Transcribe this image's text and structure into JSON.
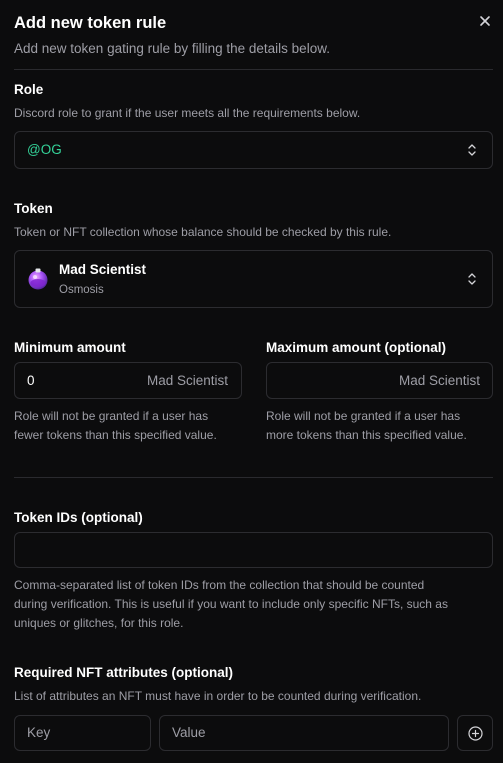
{
  "header": {
    "title": "Add new token rule",
    "subtitle": "Add new token gating rule by filling the details below.",
    "close_icon": "close-icon"
  },
  "role": {
    "label": "Role",
    "description": "Discord role to grant if the user meets all the requirements below.",
    "value": "@OG",
    "value_color": "#34d399"
  },
  "token": {
    "label": "Token",
    "description": "Token or NFT collection whose balance should be checked by this rule.",
    "name": "Mad Scientist",
    "chain": "Osmosis",
    "logo_icon": "potion-flask-icon"
  },
  "min_amount": {
    "label": "Minimum amount",
    "value": "0",
    "suffix": "Mad Scientist",
    "description_line1": "Role will not be granted if a user has",
    "description_line2": "fewer tokens than this specified value."
  },
  "max_amount": {
    "label": "Maximum amount (optional)",
    "value": "",
    "suffix": "Mad Scientist",
    "description_line1": "Role will not be granted if a user has",
    "description_line2": "more tokens than this specified value."
  },
  "token_ids": {
    "label": "Token IDs (optional)",
    "value": "",
    "description_line1": "Comma-separated list of token IDs from the collection that should be counted",
    "description_line2": "during verification. This is useful if you want to include only specific NFTs, such as",
    "description_line3": "uniques or glitches, for this role."
  },
  "nft_attributes": {
    "label": "Required NFT attributes (optional)",
    "description": "List of attributes an NFT must have in order to be counted during verification.",
    "key_placeholder": "Key",
    "value_placeholder": "Value",
    "add_icon": "plus-circle-icon"
  },
  "colors": {
    "background": "#0c0c0d",
    "border": "#2c2c30",
    "muted_text": "#9e9ea6",
    "accent_green": "#34d399"
  }
}
